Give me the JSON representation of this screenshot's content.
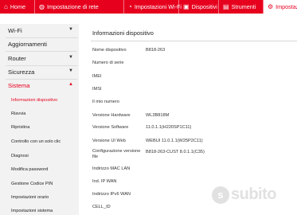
{
  "topnav": {
    "tabs": [
      {
        "label": "Home",
        "icon": "home-icon"
      },
      {
        "label": "Impostazione di rete",
        "icon": "globe-icon"
      },
      {
        "label": "Impostazioni Wi-Fi",
        "icon": "wifi-icon"
      },
      {
        "label": "Dispositivi",
        "icon": "devices-icon"
      },
      {
        "label": "Strumenti",
        "icon": "tools-icon"
      },
      {
        "label": "Impostazioni",
        "icon": "gear-icon",
        "active": true
      }
    ],
    "accent_color": "#e6001e"
  },
  "sidebar": {
    "sections": [
      {
        "label": "Wi-Fi",
        "chevron": "chevron-down-icon"
      },
      {
        "label": "Aggiornamenti"
      },
      {
        "label": "Router",
        "chevron": "chevron-down-icon"
      },
      {
        "label": "Sicurezza",
        "chevron": "chevron-down-icon"
      },
      {
        "label": "Sistema",
        "chevron": "chevron-up-icon",
        "expanded": true
      }
    ],
    "subitems": [
      {
        "label": "Informazioni dispositivo",
        "active": true
      },
      {
        "label": "Riavvia"
      },
      {
        "label": "Ripristina"
      },
      {
        "label": "Controllo con un solo clic"
      },
      {
        "label": "Diagnosi"
      },
      {
        "label": "Modifica password"
      },
      {
        "label": "Gestione Codice PIN"
      },
      {
        "label": "Impostazioni orario"
      },
      {
        "label": "Impostazioni sistema"
      }
    ]
  },
  "main": {
    "title": "Informazioni dispositivo",
    "rows": [
      {
        "label": "Nome dispositivo",
        "value": "B818-263"
      },
      {
        "label": "Numero di serie",
        "value": ""
      },
      {
        "label": "IMEI",
        "value": ""
      },
      {
        "label": "IMSI",
        "value": ""
      },
      {
        "label": "Il mio numero",
        "value": ""
      },
      {
        "label": "Versione Hardware",
        "value": "WL3B818M"
      },
      {
        "label": "Versione Software",
        "value": "11.0.1.1(H220SP1C11)"
      },
      {
        "label": "Versione UI Web",
        "value": "WEBUI 11.0.1.1(W25P2C11)"
      },
      {
        "label": "Configurazione versione file",
        "value": "B818-263-CUST 8.0.1.1(C35)"
      },
      {
        "label": "Indirizzo MAC LAN",
        "value": ""
      },
      {
        "label": "Ind. IP WAN",
        "value": ""
      },
      {
        "label": "Indirizzo IPv6 WAN",
        "value": ""
      },
      {
        "label": "CELL_ID",
        "value": ""
      }
    ]
  },
  "watermark": {
    "logo_letter": "s",
    "text": "subito"
  }
}
